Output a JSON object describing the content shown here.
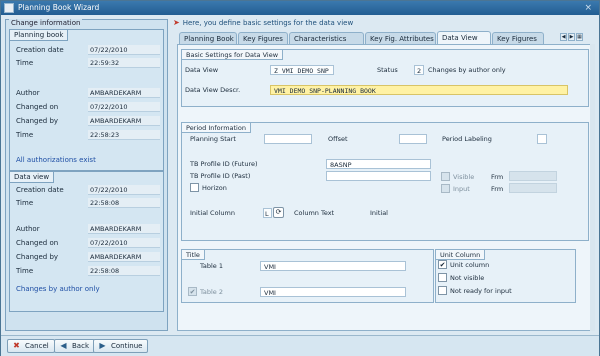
{
  "window": {
    "title": "Planning Book Wizard",
    "close": "×"
  },
  "left": {
    "section_title": "Change information",
    "planning_book": {
      "title": "Planning book",
      "rows": [
        {
          "label": "Creation date",
          "value": "07/22/2010"
        },
        {
          "label": "Time",
          "value": "22:59:32"
        },
        {
          "label": "Author",
          "value": "AMBARDEKARM"
        },
        {
          "label": "Changed on",
          "value": "07/22/2010"
        },
        {
          "label": "Changed by",
          "value": "AMBARDEKARM"
        },
        {
          "label": "Time",
          "value": "22:58:23"
        }
      ],
      "link": "All authorizations exist"
    },
    "data_view": {
      "title": "Data view",
      "rows": [
        {
          "label": "Creation date",
          "value": "07/22/2010"
        },
        {
          "label": "Time",
          "value": "22:58:08"
        },
        {
          "label": "Author",
          "value": "AMBARDEKARM"
        },
        {
          "label": "Changed on",
          "value": "07/22/2010"
        },
        {
          "label": "Changed by",
          "value": "AMBARDEKARM"
        },
        {
          "label": "Time",
          "value": "22:58:08"
        }
      ],
      "link": "Changes by author only"
    }
  },
  "hint": "Here, you define basic settings for the data view",
  "tabs": [
    "Planning Book",
    "Key Figures",
    "Characteristics",
    "Key Fig. Attributes",
    "Data View",
    "Key Figures"
  ],
  "active_tab": "Data View",
  "basic": {
    "title": "Basic Settings for Data View",
    "data_view_label": "Data View",
    "data_view_value": "Z_VMI_DEMO_SNP",
    "status_label": "Status",
    "status_value": "2",
    "status_text": "Changes by author only",
    "descr_label": "Data View Descr.",
    "descr_value": "VMI DEMO SNP-PLANNING BOOK"
  },
  "period": {
    "title": "Period Information",
    "planning_start": "Planning Start",
    "offset": "Offset",
    "period_labeling": "Period Labeling",
    "tb_future_label": "TB Profile ID (Future)",
    "tb_future_value": "8ASNP",
    "tb_past_label": "TB Profile ID (Past)",
    "tb_past_value": "",
    "horizon": "Horizon",
    "visible": "Visible",
    "input": "Input",
    "frm1": "Frm",
    "frm2": "Frm",
    "initial_column_label": "Initial Column",
    "initial_column_value": "L",
    "column_text_label": "Column Text",
    "column_text_value": "Initial"
  },
  "title_box": {
    "title": "Title",
    "table1_label": "Table 1",
    "table1_value": "VMI",
    "table2_label": "Table 2",
    "table2_value": "VMI"
  },
  "unit_column": {
    "title": "Unit Column",
    "items": [
      {
        "label": "Unit column",
        "checked": "✔"
      },
      {
        "label": "Not visible",
        "checked": ""
      },
      {
        "label": "Not ready for input",
        "checked": ""
      }
    ]
  },
  "footer": {
    "cancel": "Cancel",
    "back": "Back",
    "continue": "Continue"
  }
}
